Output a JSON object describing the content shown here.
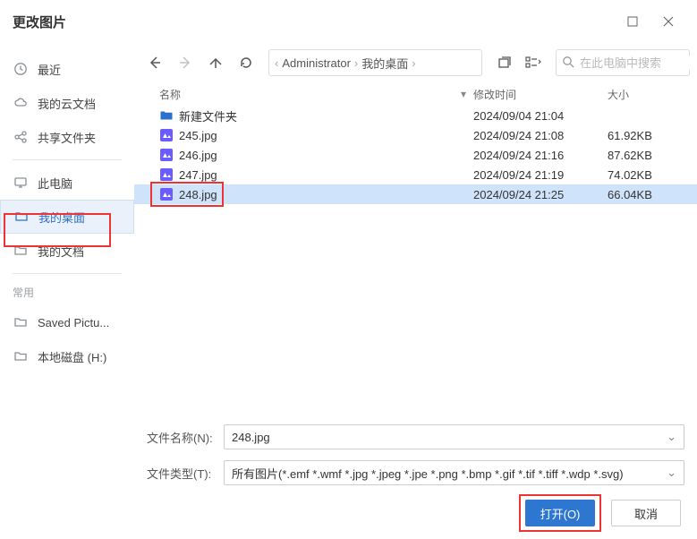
{
  "title": "更改图片",
  "sidebar": {
    "items": [
      {
        "label": "最近"
      },
      {
        "label": "我的云文档"
      },
      {
        "label": "共享文件夹"
      },
      {
        "label": "此电脑"
      },
      {
        "label": "我的桌面"
      },
      {
        "label": "我的文档"
      }
    ],
    "recent_header": "常用",
    "recent": [
      {
        "label": "Saved Pictu..."
      },
      {
        "label": "本地磁盘 (H:)"
      }
    ]
  },
  "breadcrumb": {
    "parts": [
      "Administrator",
      "我的桌面"
    ]
  },
  "search": {
    "placeholder": "在此电脑中搜索"
  },
  "columns": {
    "name": "名称",
    "mod": "修改时间",
    "size": "大小"
  },
  "files": [
    {
      "type": "folder",
      "name": "新建文件夹",
      "mod": "2024/09/04 21:04",
      "size": ""
    },
    {
      "type": "image",
      "name": "245.jpg",
      "mod": "2024/09/24 21:08",
      "size": "61.92KB"
    },
    {
      "type": "image",
      "name": "246.jpg",
      "mod": "2024/09/24 21:16",
      "size": "87.62KB"
    },
    {
      "type": "image",
      "name": "247.jpg",
      "mod": "2024/09/24 21:19",
      "size": "74.02KB"
    },
    {
      "type": "image",
      "name": "248.jpg",
      "mod": "2024/09/24 21:25",
      "size": "66.04KB",
      "selected": true
    }
  ],
  "form": {
    "filename_label": "文件名称(N):",
    "filename_value": "248.jpg",
    "filetype_label": "文件类型(T):",
    "filetype_value": "所有图片(*.emf *.wmf *.jpg *.jpeg *.jpe *.png *.bmp *.gif *.tif *.tiff *.wdp *.svg)"
  },
  "buttons": {
    "open": "打开(O)",
    "cancel": "取消"
  }
}
